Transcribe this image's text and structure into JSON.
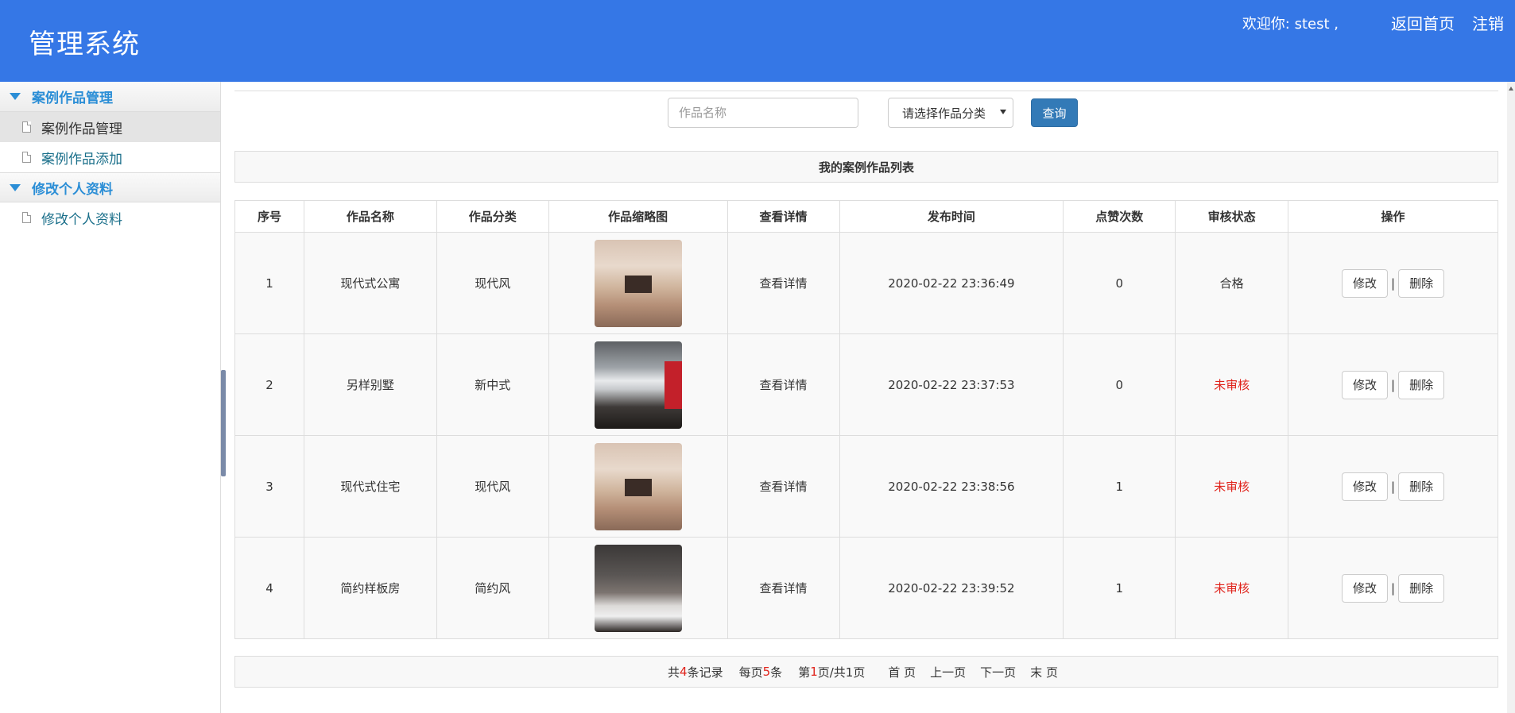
{
  "header": {
    "title": "管理系统",
    "welcome": "欢迎你: stest ,",
    "home_link": "返回首页",
    "logout_link": "注销"
  },
  "sidebar": {
    "groups": [
      {
        "label": "案例作品管理",
        "items": [
          {
            "label": "案例作品管理"
          },
          {
            "label": "案例作品添加"
          }
        ]
      },
      {
        "label": "修改个人资料",
        "items": [
          {
            "label": "修改个人资料"
          }
        ]
      }
    ]
  },
  "search": {
    "placeholder": "作品名称",
    "category_select": "请选择作品分类",
    "query_label": "查询"
  },
  "list_title": "我的案例作品列表",
  "table": {
    "headers": [
      "序号",
      "作品名称",
      "作品分类",
      "作品缩略图",
      "查看详情",
      "发布时间",
      "点赞次数",
      "审核状态",
      "操作"
    ],
    "rows": [
      {
        "no": "1",
        "name": "现代式公寓",
        "category": "现代风",
        "thumb": "lobby",
        "detail": "查看详情",
        "time": "2020-02-22 23:36:49",
        "likes": "0",
        "status": "合格",
        "edit": "修改",
        "sep": "|",
        "delete": "删除"
      },
      {
        "no": "2",
        "name": "另样别墅",
        "category": "新中式",
        "thumb": "office",
        "detail": "查看详情",
        "time": "2020-02-22 23:37:53",
        "likes": "0",
        "status": "未审核",
        "edit": "修改",
        "sep": "|",
        "delete": "删除"
      },
      {
        "no": "3",
        "name": "现代式住宅",
        "category": "现代风",
        "thumb": "lobby",
        "detail": "查看详情",
        "time": "2020-02-22 23:38:56",
        "likes": "1",
        "status": "未审核",
        "edit": "修改",
        "sep": "|",
        "delete": "删除"
      },
      {
        "no": "4",
        "name": "简约样板房",
        "category": "简约风",
        "thumb": "bedroom",
        "detail": "查看详情",
        "time": "2020-02-22 23:39:52",
        "likes": "1",
        "status": "未审核",
        "edit": "修改",
        "sep": "|",
        "delete": "删除"
      }
    ]
  },
  "pager": {
    "total_prefix": "共",
    "total": "4",
    "total_suffix": "条记录",
    "per_prefix": "每页",
    "per": "5",
    "per_suffix": "条",
    "page_prefix": "第",
    "page": "1",
    "page_suffix": "页/共1页",
    "first": "首 页",
    "prev": "上一页",
    "next": "下一页",
    "last": "末 页"
  },
  "colors": {
    "header_bg": "#3577e6",
    "accent": "#337ab7",
    "pending": "#e0231b"
  }
}
